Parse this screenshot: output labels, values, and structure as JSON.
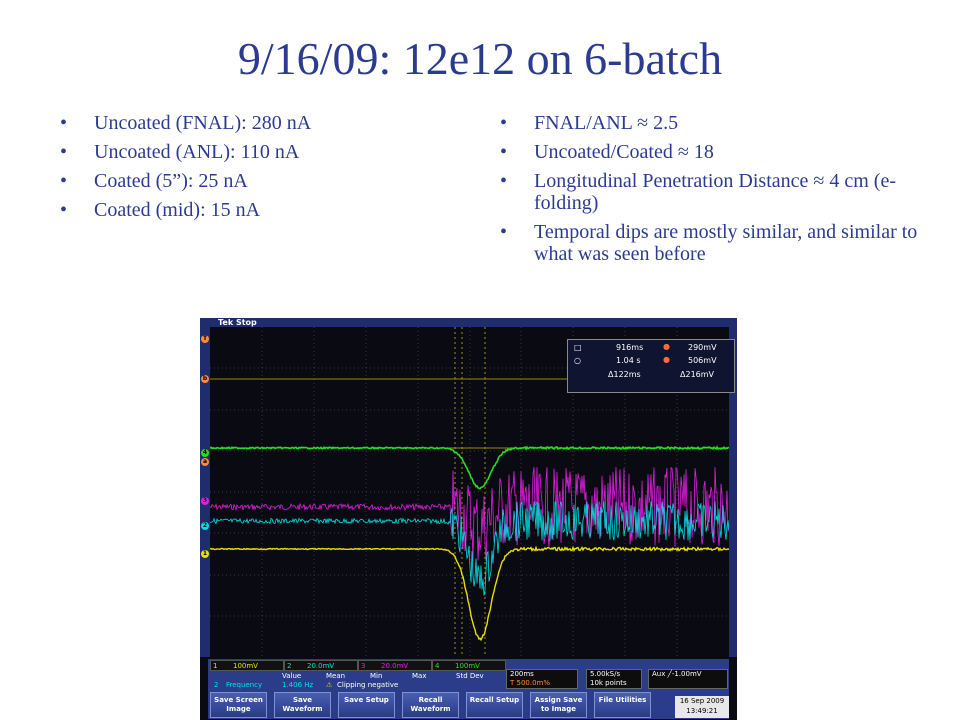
{
  "slide": {
    "title": "9/16/09: 12e12 on 6-batch",
    "bullet_glyph": "•",
    "left_bullets": [
      "Uncoated (FNAL): 280 nA",
      "Uncoated (ANL): 110 nA",
      "Coated (5”): 25 nA",
      "Coated (mid): 15 nA"
    ],
    "right_bullets": [
      "FNAL/ANL ≈ 2.5",
      "Uncoated/Coated ≈ 18",
      "Longitudinal Penetration Distance ≈ 4 cm (e-folding)",
      "Temporal dips are mostly similar, and similar to what was seen before"
    ]
  },
  "scope": {
    "header": {
      "brand": "Tek",
      "state": "Stop",
      "trigger_marker": "T"
    },
    "cursor_readout": {
      "row1_left": "916ms",
      "row1_right": "290mV",
      "row2_left": "1.04 s",
      "row2_right": "506mV",
      "row3_left": "Δ122ms",
      "row3_right": "Δ216mV"
    },
    "channels": [
      {
        "id": "1",
        "scale": "100mV",
        "color": "#e8e000"
      },
      {
        "id": "2",
        "scale": "20.0mV",
        "color": "#00e0e0"
      },
      {
        "id": "3",
        "scale": "20.0mV",
        "color": "#e020e0"
      },
      {
        "id": "4",
        "scale": "100mV",
        "color": "#20e020"
      }
    ],
    "side_markers": [
      "T",
      "b",
      "4",
      "a",
      "3",
      "2",
      "1"
    ],
    "measurement": {
      "headers": [
        "Value",
        "Mean",
        "Min",
        "Max",
        "Std Dev"
      ],
      "channel": "2",
      "name": "Frequency",
      "value": "1.406 Hz",
      "warning": "Clipping negative"
    },
    "timebase": {
      "scale": "200ms",
      "position": "500.0m%"
    },
    "acquisition": {
      "rate": "5.00kS/s",
      "points": "10k points"
    },
    "trigger": {
      "source": "Aux",
      "level": "-1.00mV"
    },
    "buttons": [
      "Save Screen Image",
      "Save Waveform",
      "Save Setup",
      "Recall Waveform",
      "Recall Setup",
      "Assign Save to Image",
      "File Utilities"
    ],
    "date": "16 Sep 2009",
    "time": "13:49:21"
  }
}
